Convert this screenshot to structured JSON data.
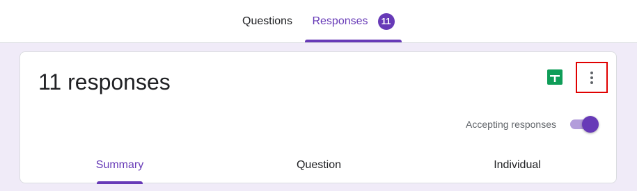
{
  "tabs": {
    "questions_label": "Questions",
    "responses_label": "Responses",
    "responses_count": "11"
  },
  "card": {
    "title": "11 responses",
    "accepting_label": "Accepting responses",
    "accepting_on": true
  },
  "sub_tabs": {
    "summary": "Summary",
    "question": "Question",
    "individual": "Individual",
    "active": "Summary"
  },
  "icons": {
    "sheets": "google-sheets-icon",
    "more": "more-vert-icon"
  },
  "colors": {
    "accent": "#673ab7",
    "background": "#f0ebf8",
    "sheets_green": "#0f9d58",
    "highlight_red": "#e00000"
  }
}
